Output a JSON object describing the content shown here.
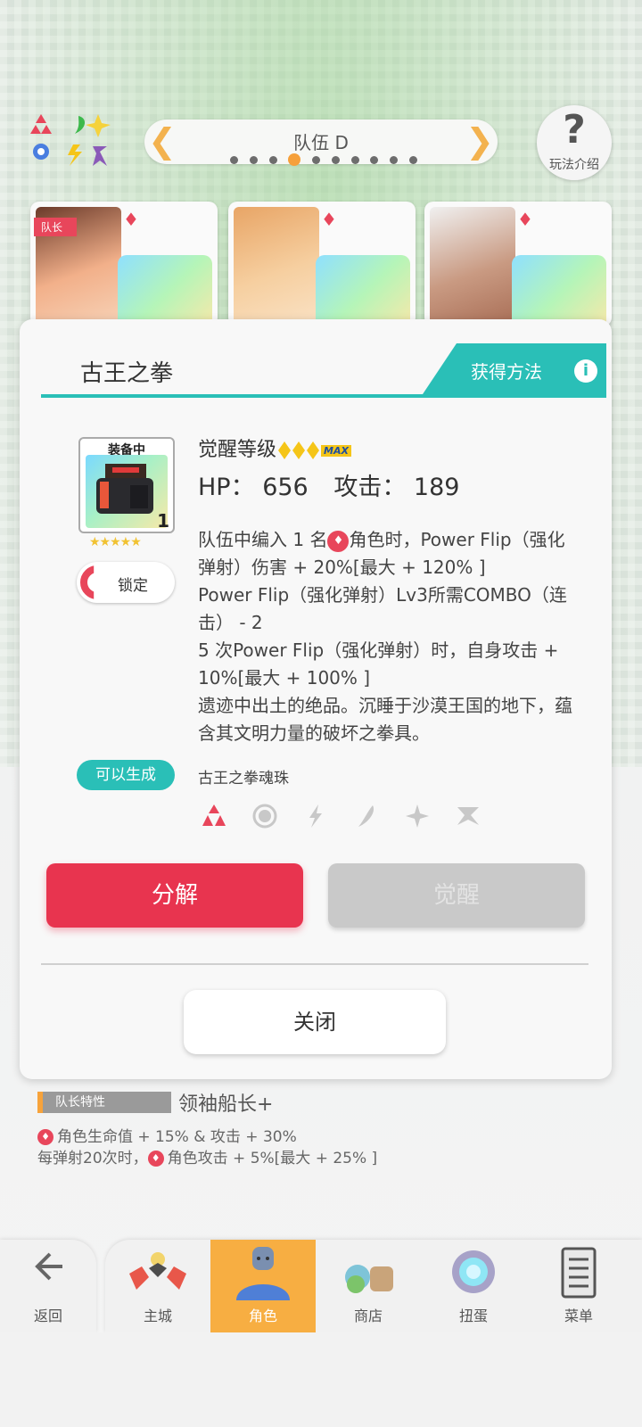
{
  "top_bar": {
    "team_name": "队伍 D",
    "help_label": "玩法介绍",
    "help_icon": "question-mark-icon"
  },
  "characters": {
    "leader_tag": "队长"
  },
  "item_modal": {
    "title": "古王之拳",
    "acquire_label": "获得方法",
    "equipped_label": "装备中",
    "quantity": "1",
    "lock_label": "锁定",
    "awaken_label": "觉醒等级",
    "max_label": "MAX",
    "hp_label": "HP：",
    "hp_value": "656",
    "attack_label": "攻击：",
    "attack_value": "189",
    "effect_line1_a": "队伍中编入 1 名",
    "effect_line1_b": "角色时，Power Flip（强化弹射）伤害 + 20%[最大 + 120% ]",
    "effect_line2": "Power Flip（强化弹射）Lv3所需COMBO（连击） - 2",
    "effect_line3": "5 次Power Flip（强化弹射）时，自身攻击 + 10%[最大 + 100% ]",
    "flavor_text": "遗迹中出土的绝品。沉睡于沙漠王国的地下，蕴含其文明力量的破坏之拳具。",
    "craftable_label": "可以生成",
    "soul_orb_label": "古王之拳魂珠",
    "element_icons": [
      "fire-icon",
      "light-icon",
      "thunder-icon",
      "wind-icon",
      "water-icon",
      "dark-icon"
    ],
    "decompose_label": "分解",
    "awaken_button_label": "觉醒",
    "close_label": "关闭"
  },
  "leader_skill": {
    "tag": "队长特性",
    "name": "领袖船长+",
    "line1": "角色生命值 + 15% & 攻击 + 30%",
    "line2_a": "每弹射20次时，",
    "line2_b": "角色攻击 + 5%[最大 + 25% ]"
  },
  "nav": {
    "back": "返回",
    "items": [
      {
        "label": "主城",
        "icon": "castle-icon"
      },
      {
        "label": "角色",
        "icon": "character-icon",
        "active": true
      },
      {
        "label": "商店",
        "icon": "shop-icon"
      },
      {
        "label": "扭蛋",
        "icon": "gacha-icon"
      },
      {
        "label": "菜单",
        "icon": "menu-icon"
      }
    ]
  },
  "colors": {
    "accent_teal": "#2abfb7",
    "accent_red": "#e8344f",
    "nav_active": "#f7ae42"
  }
}
